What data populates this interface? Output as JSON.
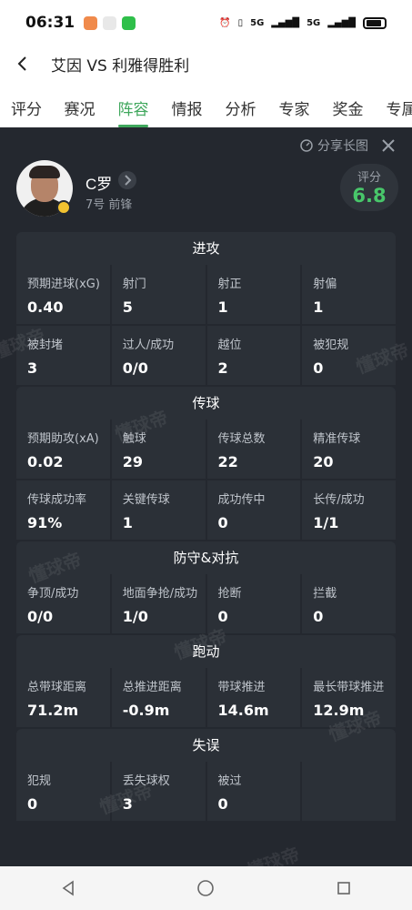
{
  "status": {
    "time": "06:31",
    "network": "5G"
  },
  "nav": {
    "title": "艾因 VS 利雅得胜利"
  },
  "tabs": [
    "评分",
    "赛况",
    "阵容",
    "情报",
    "分析",
    "专家",
    "奖金",
    "专属"
  ],
  "active_tab": "阵容",
  "actions": {
    "share_label": "分享长图"
  },
  "player": {
    "name": "C罗",
    "info": "7号 前锋",
    "rating_label": "评分",
    "rating_value": "6.8"
  },
  "sections": [
    {
      "title": "进攻",
      "rows": [
        [
          {
            "label": "预期进球(xG)",
            "value": "0.40"
          },
          {
            "label": "射门",
            "value": "5"
          },
          {
            "label": "射正",
            "value": "1"
          },
          {
            "label": "射偏",
            "value": "1"
          }
        ],
        [
          {
            "label": "被封堵",
            "value": "3"
          },
          {
            "label": "过人/成功",
            "value": "0/0"
          },
          {
            "label": "越位",
            "value": "2"
          },
          {
            "label": "被犯规",
            "value": "0"
          }
        ]
      ]
    },
    {
      "title": "传球",
      "rows": [
        [
          {
            "label": "预期助攻(xA)",
            "value": "0.02"
          },
          {
            "label": "触球",
            "value": "29"
          },
          {
            "label": "传球总数",
            "value": "22"
          },
          {
            "label": "精准传球",
            "value": "20"
          }
        ],
        [
          {
            "label": "传球成功率",
            "value": "91%"
          },
          {
            "label": "关键传球",
            "value": "1"
          },
          {
            "label": "成功传中",
            "value": "0"
          },
          {
            "label": "长传/成功",
            "value": "1/1"
          }
        ]
      ]
    },
    {
      "title": "防守&对抗",
      "rows": [
        [
          {
            "label": "争顶/成功",
            "value": "0/0"
          },
          {
            "label": "地面争抢/成功",
            "value": "1/0"
          },
          {
            "label": "抢断",
            "value": "0"
          },
          {
            "label": "拦截",
            "value": "0"
          }
        ]
      ]
    },
    {
      "title": "跑动",
      "rows": [
        [
          {
            "label": "总带球距离",
            "value": "71.2m"
          },
          {
            "label": "总推进距离",
            "value": "-0.9m"
          },
          {
            "label": "带球推进",
            "value": "14.6m"
          },
          {
            "label": "最长带球推进",
            "value": "12.9m"
          }
        ]
      ]
    },
    {
      "title": "失误",
      "rows": [
        [
          {
            "label": "犯规",
            "value": "0"
          },
          {
            "label": "丢失球权",
            "value": "3"
          },
          {
            "label": "被过",
            "value": "0"
          },
          {
            "label": "",
            "value": ""
          }
        ]
      ]
    }
  ],
  "watermark": "懂球帝"
}
